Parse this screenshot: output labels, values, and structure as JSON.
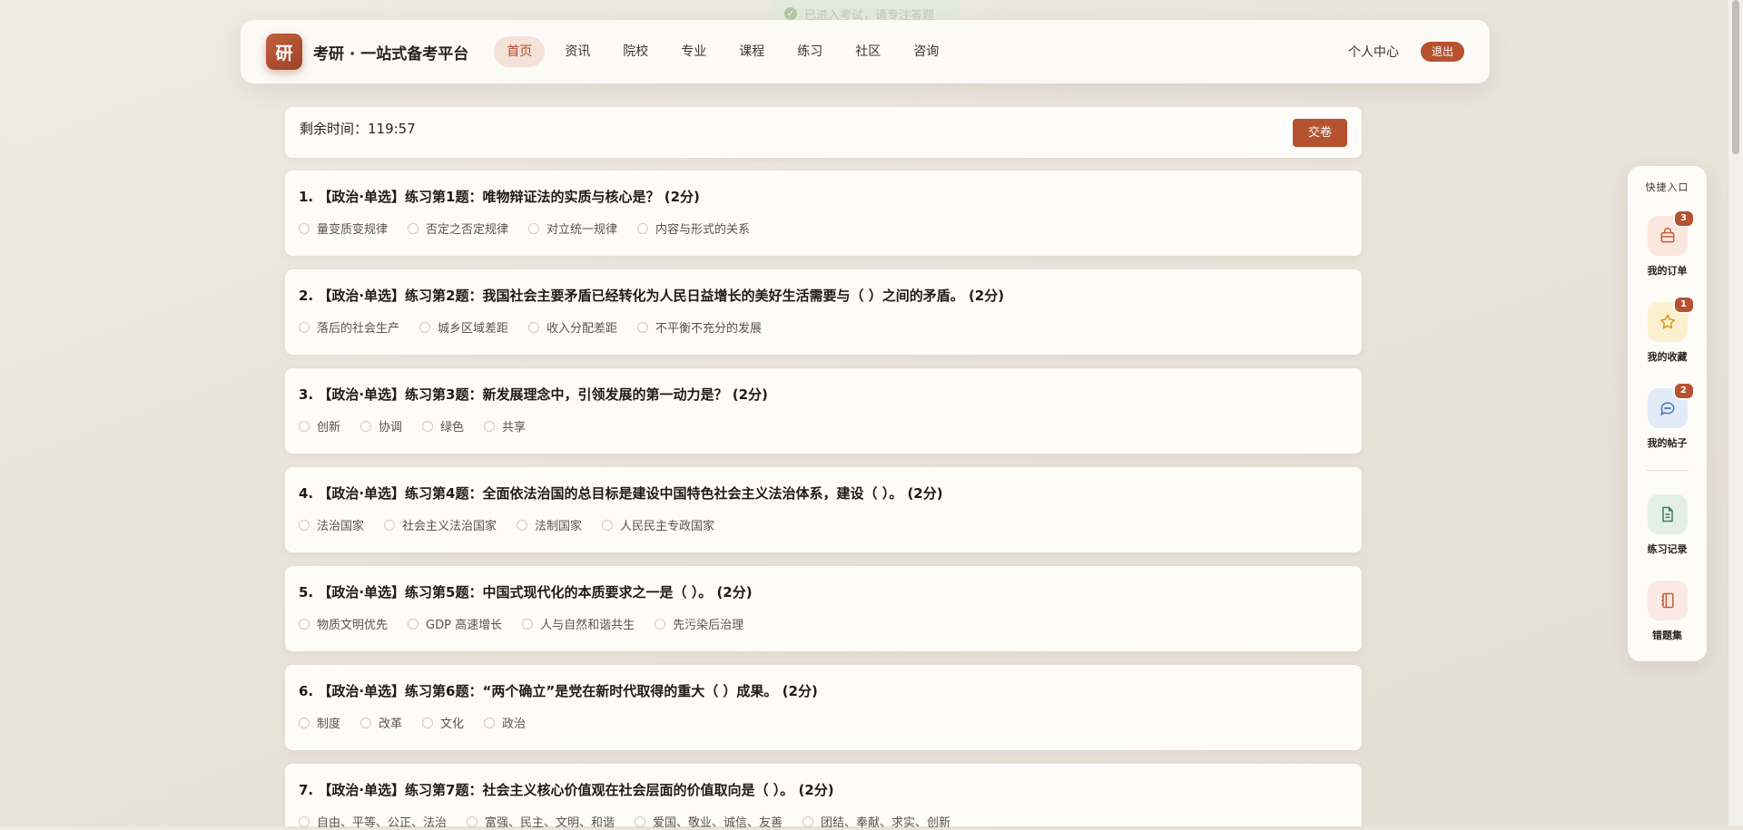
{
  "toast": {
    "text": "已进入考试，请专注答题",
    "icon": "check-circle-icon"
  },
  "header": {
    "logo_char": "研",
    "brand": "考研 · 一站式备考平台",
    "nav": [
      {
        "label": "首页",
        "active": true
      },
      {
        "label": "资讯"
      },
      {
        "label": "院校"
      },
      {
        "label": "专业"
      },
      {
        "label": "课程"
      },
      {
        "label": "练习"
      },
      {
        "label": "社区"
      },
      {
        "label": "咨询"
      }
    ],
    "user_center": "个人中心",
    "logout": "退出"
  },
  "exam": {
    "timer_label": "剩余时间：119:57",
    "submit_label": "交卷"
  },
  "questions": [
    {
      "title": "1. 【政治·单选】练习第1题：唯物辩证法的实质与核心是？ (2分)",
      "options": [
        "量变质变规律",
        "否定之否定规律",
        "对立统一规律",
        "内容与形式的关系"
      ]
    },
    {
      "title": "2. 【政治·单选】练习第2题：我国社会主要矛盾已经转化为人民日益增长的美好生活需要与（ ）之间的矛盾。 (2分)",
      "options": [
        "落后的社会生产",
        "城乡区域差距",
        "收入分配差距",
        "不平衡不充分的发展"
      ]
    },
    {
      "title": "3. 【政治·单选】练习第3题：新发展理念中，引领发展的第一动力是？ (2分)",
      "options": [
        "创新",
        "协调",
        "绿色",
        "共享"
      ]
    },
    {
      "title": "4. 【政治·单选】练习第4题：全面依法治国的总目标是建设中国特色社会主义法治体系，建设（ ）。 (2分)",
      "options": [
        "法治国家",
        "社会主义法治国家",
        "法制国家",
        "人民民主专政国家"
      ]
    },
    {
      "title": "5. 【政治·单选】练习第5题：中国式现代化的本质要求之一是（ ）。 (2分)",
      "options": [
        "物质文明优先",
        "GDP 高速增长",
        "人与自然和谐共生",
        "先污染后治理"
      ]
    },
    {
      "title": "6. 【政治·单选】练习第6题：“两个确立”是党在新时代取得的重大（ ）成果。 (2分)",
      "options": [
        "制度",
        "改革",
        "文化",
        "政治"
      ]
    },
    {
      "title": "7. 【政治·单选】练习第7题：社会主义核心价值观在社会层面的价值取向是（ ）。 (2分)",
      "options": [
        "自由、平等、公正、法治",
        "富强、民主、文明、和谐",
        "爱国、敬业、诚信、友善",
        "团结、奉献、求实、创新"
      ]
    }
  ],
  "quick": {
    "title": "快捷入口",
    "items": [
      {
        "label": "我的订单",
        "badge": "3",
        "icon": "shopping-bag-icon"
      },
      {
        "label": "我的收藏",
        "badge": "1",
        "icon": "star-icon"
      },
      {
        "label": "我的帖子",
        "badge": "2",
        "icon": "chat-bubble-icon"
      },
      {
        "label": "练习记录",
        "icon": "document-icon"
      },
      {
        "label": "错题集",
        "icon": "notebook-icon"
      }
    ]
  },
  "colors": {
    "accent": "#b5522f",
    "nav_active_bg": "#f4e2d8"
  }
}
